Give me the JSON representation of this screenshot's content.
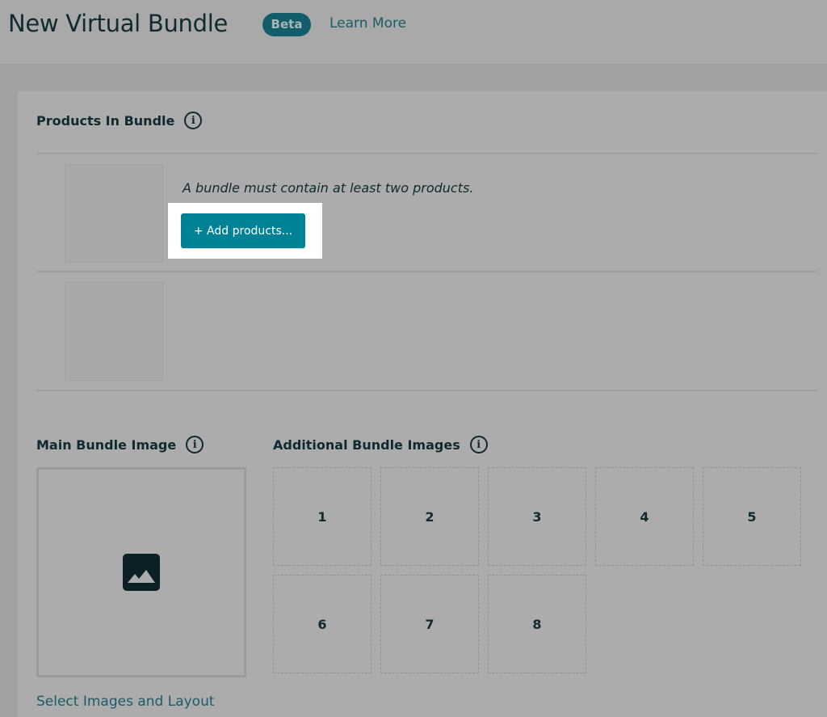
{
  "header": {
    "title": "New Virtual Bundle",
    "badge": "Beta",
    "learn_more": "Learn More"
  },
  "products_section": {
    "heading": "Products In Bundle",
    "info_icon": "info-icon",
    "hint": "A bundle must contain at least two products.",
    "add_button": "+ Add products..."
  },
  "main_image": {
    "heading": "Main Bundle Image",
    "info_icon": "info-icon",
    "placeholder_icon": "image-icon"
  },
  "additional_images": {
    "heading": "Additional Bundle Images",
    "info_icon": "info-icon",
    "slots": [
      "1",
      "2",
      "3",
      "4",
      "5",
      "6",
      "7",
      "8"
    ]
  },
  "select_link": "Select Images and Layout",
  "colors": {
    "accent_button": "#008296",
    "link": "#1a5c69",
    "badge": "#125d6b",
    "text": "#0f2a30"
  }
}
